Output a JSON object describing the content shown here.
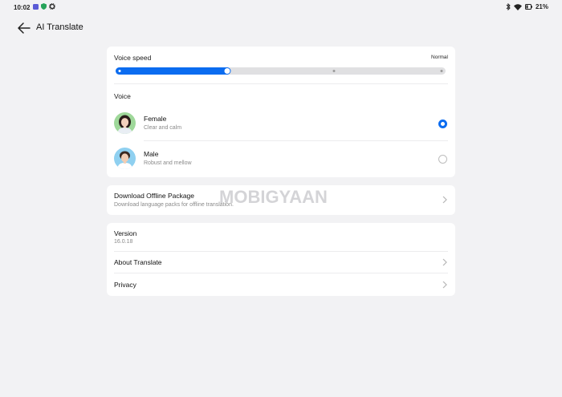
{
  "status_bar": {
    "time": "10:02",
    "battery": "21%",
    "left_icons": [
      "app-icon",
      "shield-icon",
      "gear-icon"
    ],
    "right_icons": [
      "bluetooth-icon",
      "wifi-icon",
      "battery-icon"
    ]
  },
  "header": {
    "title": "AI Translate"
  },
  "voice_speed": {
    "label": "Voice speed",
    "value": "Normal",
    "steps": 4,
    "selected_step": 2,
    "accent": "#0b6cf0"
  },
  "voice": {
    "label": "Voice",
    "options": [
      {
        "name": "Female",
        "description": "Clear and calm",
        "selected": true
      },
      {
        "name": "Male",
        "description": "Robust and mellow",
        "selected": false
      }
    ]
  },
  "offline": {
    "title": "Download Offline Package",
    "subtitle": "Download language packs for offline translation."
  },
  "info": {
    "version_label": "Version",
    "version_value": "16.0.18",
    "about": "About Translate",
    "privacy": "Privacy"
  },
  "watermark": "MOBIGYAAN"
}
